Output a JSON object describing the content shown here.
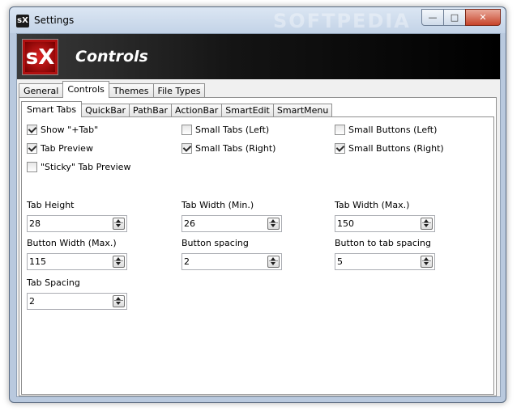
{
  "window": {
    "title": "Settings",
    "icon_label": "sX",
    "watermark": "SOFTPEDIA",
    "caption_buttons": {
      "minimize": "—",
      "maximize": "□",
      "close": "✕"
    }
  },
  "banner": {
    "logo_text": "sX",
    "title": "Controls"
  },
  "tabs": [
    {
      "label": "General"
    },
    {
      "label": "Controls",
      "active": true
    },
    {
      "label": "Themes"
    },
    {
      "label": "File Types"
    }
  ],
  "subtabs": [
    {
      "label": "Smart Tabs",
      "active": true
    },
    {
      "label": "QuickBar"
    },
    {
      "label": "PathBar"
    },
    {
      "label": "ActionBar"
    },
    {
      "label": "SmartEdit"
    },
    {
      "label": "SmartMenu"
    }
  ],
  "checkboxes": {
    "show_plus_tab": {
      "label": "Show \"+Tab\"",
      "checked": true
    },
    "small_tabs_left": {
      "label": "Small Tabs (Left)",
      "checked": false
    },
    "small_buttons_left": {
      "label": "Small Buttons (Left)",
      "checked": false
    },
    "tab_preview": {
      "label": "Tab Preview",
      "checked": true
    },
    "small_tabs_right": {
      "label": "Small Tabs (Right)",
      "checked": true
    },
    "small_buttons_right": {
      "label": "Small Buttons (Right)",
      "checked": true
    },
    "sticky_tab_preview": {
      "label": "\"Sticky\" Tab Preview",
      "checked": false
    }
  },
  "fields": {
    "tab_height": {
      "label": "Tab Height",
      "value": "28"
    },
    "tab_width_min": {
      "label": "Tab Width (Min.)",
      "value": "26"
    },
    "tab_width_max": {
      "label": "Tab Width (Max.)",
      "value": "150"
    },
    "button_width_max": {
      "label": "Button Width (Max.)",
      "value": "115"
    },
    "button_spacing": {
      "label": "Button spacing",
      "value": "2"
    },
    "button_to_tab_spacing": {
      "label": "Button to tab spacing",
      "value": "5"
    },
    "tab_spacing": {
      "label": "Tab Spacing",
      "value": "2"
    }
  }
}
